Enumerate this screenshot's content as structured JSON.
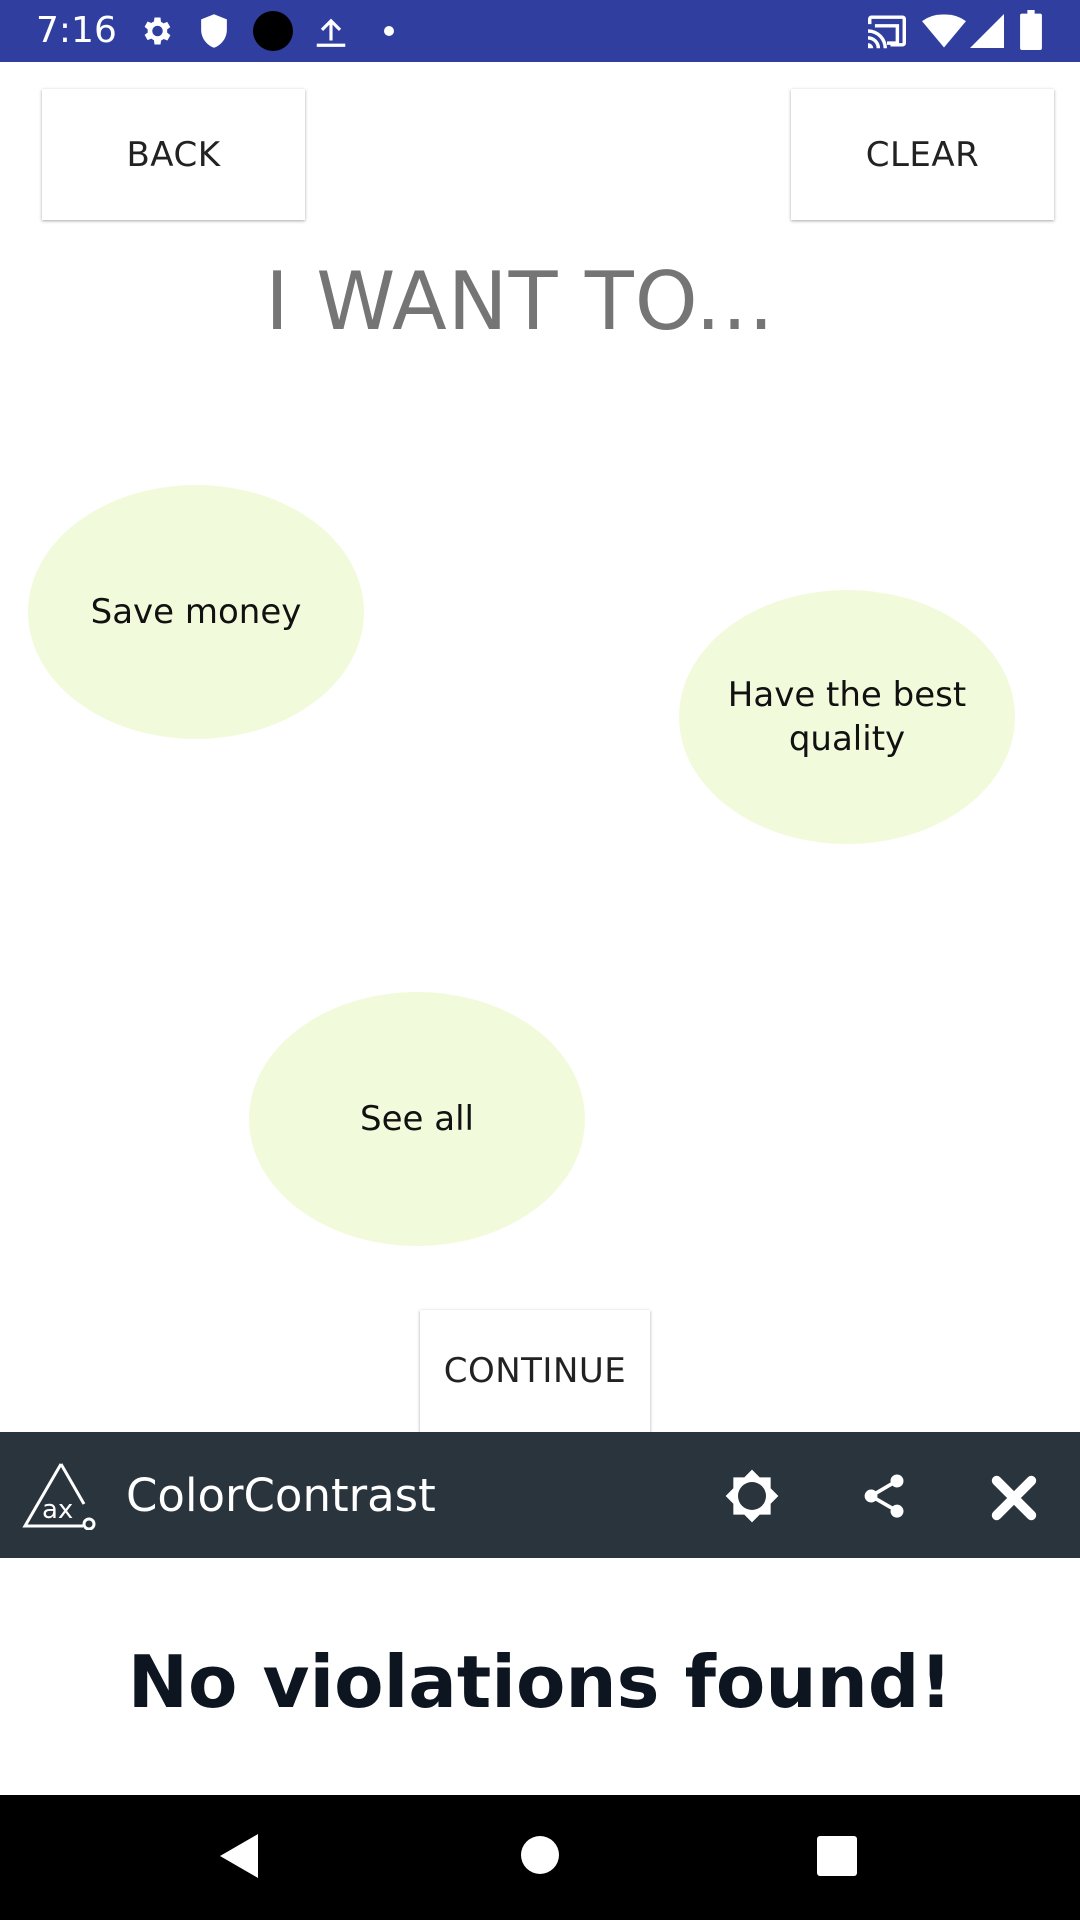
{
  "status_bar": {
    "time": "7:16",
    "left_icons": [
      "gear-icon",
      "shield-icon",
      "circle-icon",
      "upload-icon",
      "dot-icon"
    ],
    "right_icons": [
      "cast-icon",
      "wifi-icon",
      "signal-icon",
      "battery-icon"
    ]
  },
  "toolbar": {
    "back_label": "BACK",
    "clear_label": "CLEAR"
  },
  "main": {
    "heading": "I WANT TO...",
    "options": [
      {
        "label": "Save money"
      },
      {
        "label": "Have the best quality"
      },
      {
        "label": "See all"
      }
    ],
    "continue_label": "CONTINUE"
  },
  "accessibility_bar": {
    "title": "ColorContrast",
    "icons": [
      "ax-logo-icon",
      "brightness-icon",
      "share-icon",
      "close-icon"
    ]
  },
  "result": {
    "message": "No violations found!"
  },
  "colors": {
    "status_bar": "#303f9f",
    "bubble": "#f1fbdb",
    "ax_bar": "#29343d",
    "heading": "#757575"
  }
}
